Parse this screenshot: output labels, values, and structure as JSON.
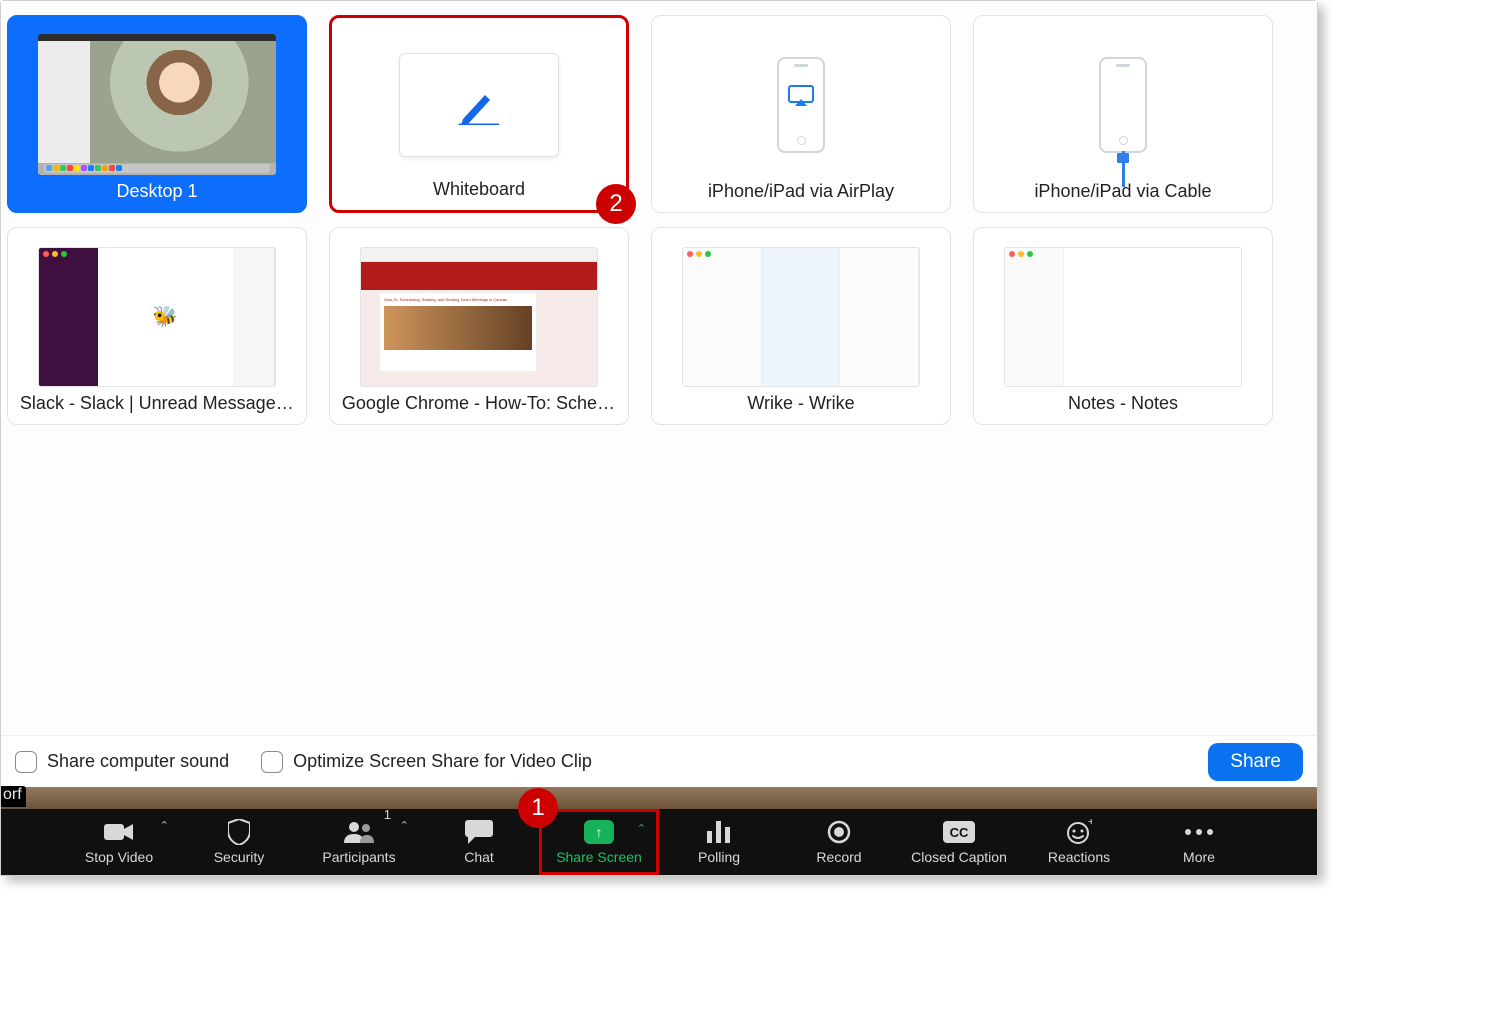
{
  "callouts": {
    "one": "1",
    "two": "2"
  },
  "panel": {
    "tiles": [
      {
        "label": "Desktop 1"
      },
      {
        "label": "Whiteboard"
      },
      {
        "label": "iPhone/iPad via AirPlay"
      },
      {
        "label": "iPhone/iPad via Cable"
      },
      {
        "label": "Slack - Slack | Unread Messages |…"
      },
      {
        "label": "Google Chrome - How-To: Schedul…"
      },
      {
        "label": "Wrike - Wrike"
      },
      {
        "label": "Notes - Notes"
      }
    ],
    "footer": {
      "opt_sound": "Share computer sound",
      "opt_optimize": "Optimize Screen Share for Video Clip",
      "share_button": "Share"
    }
  },
  "name_fragment": "orf",
  "toolbar": {
    "stop_video": "Stop Video",
    "security": "Security",
    "participants": "Participants",
    "participants_count": "1",
    "chat": "Chat",
    "share_screen": "Share Screen",
    "polling": "Polling",
    "record": "Record",
    "closed_caption": "Closed Caption",
    "reactions": "Reactions",
    "more": "More"
  }
}
